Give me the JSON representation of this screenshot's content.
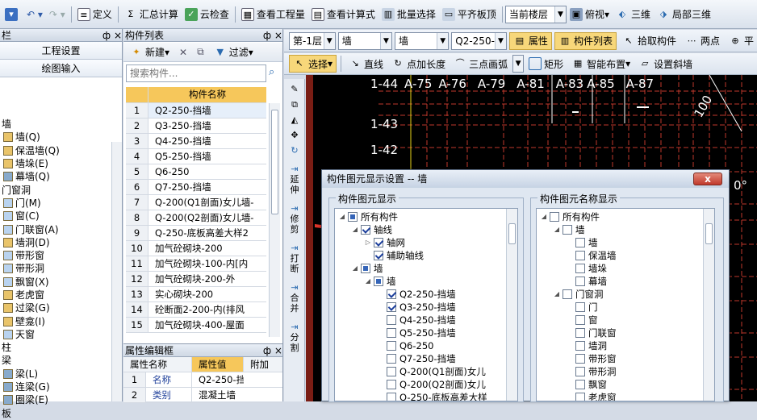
{
  "toolbar": {
    "define": "定义",
    "sum_calc": "汇总计算",
    "cloud_check": "云检查",
    "view_quantity": "查看工程量",
    "view_formula": "查看计算式",
    "batch_select": "批量选择",
    "flat_top": "平齐板顶",
    "floor_select": "当前楼层",
    "top_view": "俯视",
    "three_d": "三维",
    "local_3d": "局部三维"
  },
  "toolbar2": {
    "floor": "第-1层",
    "category": "墙",
    "type": "墙",
    "component": "Q2-250-",
    "properties": "属性",
    "component_list": "构件列表",
    "pick": "拾取构件",
    "two_points": "两点",
    "flat": "平"
  },
  "toolbar3": {
    "select": "选择",
    "line": "直线",
    "point_length": "点加长度",
    "three_point_arc": "三点画弧",
    "rect": "矩形",
    "smart_layout": "智能布置",
    "set_slope_wall": "设置斜墙"
  },
  "left_panel": {
    "title": "栏",
    "pin": "ф",
    "close": "×",
    "btn_project": "工程设置",
    "btn_draw": "绘图输入",
    "items": [
      "墙",
      "墙(Q)",
      "保温墙(Q)",
      "墙垛(E)",
      "幕墙(Q)",
      "门窗洞",
      "门(M)",
      "窗(C)",
      "门联窗(A)",
      "墙洞(D)",
      "带形窗",
      "带形洞",
      "飘窗(X)",
      "老虎窗",
      "过梁(G)",
      "壁龛(I)",
      "天窗",
      "柱",
      "梁",
      "梁(L)",
      "连梁(G)",
      "圈梁(E)",
      "板"
    ]
  },
  "mid_panel": {
    "title": "构件列表",
    "new": "新建",
    "filter": "过滤",
    "search_placeholder": "搜索构件...",
    "col_header": "构件名称",
    "rows": [
      "Q2-250-挡墙",
      "Q3-250-挡墙",
      "Q4-250-挡墙",
      "Q5-250-挡墙",
      "Q6-250",
      "Q7-250-挡墙",
      "Q-200(Q1剖面)女儿墙-",
      "Q-200(Q2剖面)女儿墙-",
      "Q-250-底板高差大样2",
      "加气砼砌块-200",
      "加气砼砌块-100-内[内",
      "加气砼砌块-200-外",
      "实心砌块-200",
      "砼断面2-200-内(排风",
      "加气砼砌块-400-屋面"
    ],
    "prop_title": "属性编辑框",
    "prop_col1": "属性名称",
    "prop_col2": "属性值",
    "prop_col3": "附加",
    "prop_name_label": "名称",
    "prop_name_value": "Q2-250-挡",
    "prop_cat_label": "类别",
    "prop_cat_value": "混凝土墙"
  },
  "vstrip": [
    "延伸",
    "修剪",
    "打断",
    "合并",
    "分割"
  ],
  "canvas": {
    "labels_top": [
      "1-44",
      "A-75",
      "A-76",
      "A-79",
      "A-81",
      "A-83",
      "A-85",
      "A-87"
    ],
    "labels_left": [
      "1-43",
      "1-42"
    ],
    "dim": "100",
    "deg": "0°"
  },
  "dialog": {
    "title": "构件图元显示设置 -- 墙",
    "close": "x",
    "left_group": "构件图元显示",
    "right_group": "构件图元名称显示",
    "left_tree": [
      {
        "label": "所有构件",
        "level": 0,
        "check": "part",
        "exp": "◢"
      },
      {
        "label": "轴线",
        "level": 1,
        "check": "on",
        "exp": "◢"
      },
      {
        "label": "轴网",
        "level": 2,
        "check": "on",
        "exp": "▷"
      },
      {
        "label": "辅助轴线",
        "level": 2,
        "check": "on",
        "exp": ""
      },
      {
        "label": "墙",
        "level": 1,
        "check": "part",
        "exp": "◢"
      },
      {
        "label": "墙",
        "level": 2,
        "check": "part",
        "exp": "◢"
      },
      {
        "label": "Q2-250-挡墙",
        "level": 3,
        "check": "on",
        "exp": ""
      },
      {
        "label": "Q3-250-挡墙",
        "level": 3,
        "check": "on",
        "exp": ""
      },
      {
        "label": "Q4-250-挡墙",
        "level": 3,
        "check": "off",
        "exp": ""
      },
      {
        "label": "Q5-250-挡墙",
        "level": 3,
        "check": "off",
        "exp": ""
      },
      {
        "label": "Q6-250",
        "level": 3,
        "check": "off",
        "exp": ""
      },
      {
        "label": "Q7-250-挡墙",
        "level": 3,
        "check": "off",
        "exp": ""
      },
      {
        "label": "Q-200(Q1剖面)女儿",
        "level": 3,
        "check": "off",
        "exp": ""
      },
      {
        "label": "Q-200(Q2剖面)女儿",
        "level": 3,
        "check": "off",
        "exp": ""
      },
      {
        "label": "Q-250-底板高差大样",
        "level": 3,
        "check": "off",
        "exp": ""
      }
    ],
    "right_tree": [
      {
        "label": "所有构件",
        "level": 0,
        "exp": "◢"
      },
      {
        "label": "墙",
        "level": 1,
        "exp": "◢"
      },
      {
        "label": "墙",
        "level": 2,
        "exp": ""
      },
      {
        "label": "保温墙",
        "level": 2,
        "exp": ""
      },
      {
        "label": "墙垛",
        "level": 2,
        "exp": ""
      },
      {
        "label": "幕墙",
        "level": 2,
        "exp": ""
      },
      {
        "label": "门窗洞",
        "level": 1,
        "exp": "◢"
      },
      {
        "label": "门",
        "level": 2,
        "exp": ""
      },
      {
        "label": "窗",
        "level": 2,
        "exp": ""
      },
      {
        "label": "门联窗",
        "level": 2,
        "exp": ""
      },
      {
        "label": "墙洞",
        "level": 2,
        "exp": ""
      },
      {
        "label": "带形窗",
        "level": 2,
        "exp": ""
      },
      {
        "label": "带形洞",
        "level": 2,
        "exp": ""
      },
      {
        "label": "飘窗",
        "level": 2,
        "exp": ""
      },
      {
        "label": "老虎窗",
        "level": 2,
        "exp": ""
      }
    ]
  },
  "colors": {
    "accent_orange": "#f6c75b",
    "canvas_bg": "#000000",
    "arrow_red": "#e0362b"
  }
}
